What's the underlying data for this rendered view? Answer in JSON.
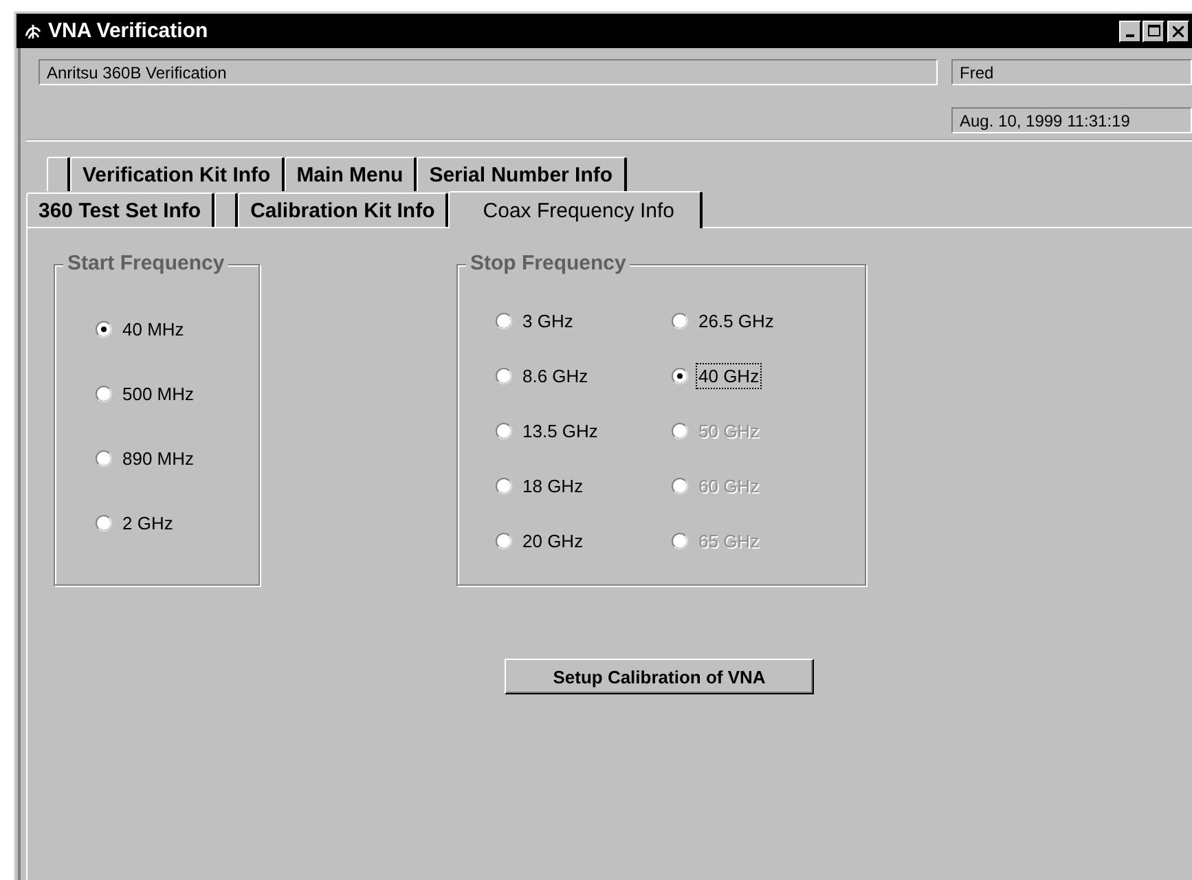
{
  "window": {
    "title": "VNA Verification"
  },
  "header": {
    "title_field": "Anritsu 360B Verification",
    "user_field": "Fred",
    "datetime": "Aug. 10, 1999 11:31:19"
  },
  "tab_rows": [
    [
      {
        "kind": "blank",
        "selected": false
      },
      {
        "kind": "tab",
        "label": "Verification Kit Info",
        "selected": false
      },
      {
        "kind": "tab",
        "label": "Main Menu",
        "selected": false
      },
      {
        "kind": "tab",
        "label": "Serial Number Info",
        "selected": false
      }
    ],
    [
      {
        "kind": "tab",
        "label": "360 Test Set Info",
        "selected": false
      },
      {
        "kind": "blank",
        "selected": false
      },
      {
        "kind": "tab",
        "label": "Calibration Kit Info",
        "selected": false
      },
      {
        "kind": "tab",
        "label": "Coax Frequency Info",
        "selected": true
      }
    ]
  ],
  "start_frequency": {
    "title": "Start Frequency",
    "options": [
      {
        "label": "40 MHz",
        "selected": true,
        "disabled": false
      },
      {
        "label": "500 MHz",
        "selected": false,
        "disabled": false
      },
      {
        "label": "890 MHz",
        "selected": false,
        "disabled": false
      },
      {
        "label": "2 GHz",
        "selected": false,
        "disabled": false
      }
    ]
  },
  "stop_frequency": {
    "title": "Stop Frequency",
    "options": [
      {
        "label": "3 GHz",
        "selected": false,
        "disabled": false,
        "focused": false
      },
      {
        "label": "26.5 GHz",
        "selected": false,
        "disabled": false,
        "focused": false
      },
      {
        "label": "8.6 GHz",
        "selected": false,
        "disabled": false,
        "focused": false
      },
      {
        "label": "40 GHz",
        "selected": true,
        "disabled": false,
        "focused": true
      },
      {
        "label": "13.5 GHz",
        "selected": false,
        "disabled": false,
        "focused": false
      },
      {
        "label": "50 GHz",
        "selected": false,
        "disabled": true,
        "focused": false
      },
      {
        "label": "18 GHz",
        "selected": false,
        "disabled": false,
        "focused": false
      },
      {
        "label": "60 GHz",
        "selected": false,
        "disabled": true,
        "focused": false
      },
      {
        "label": "20 GHz",
        "selected": false,
        "disabled": false,
        "focused": false
      },
      {
        "label": "65 GHz",
        "selected": false,
        "disabled": true,
        "focused": false
      }
    ]
  },
  "button": {
    "label": "Setup Calibration of VNA"
  }
}
